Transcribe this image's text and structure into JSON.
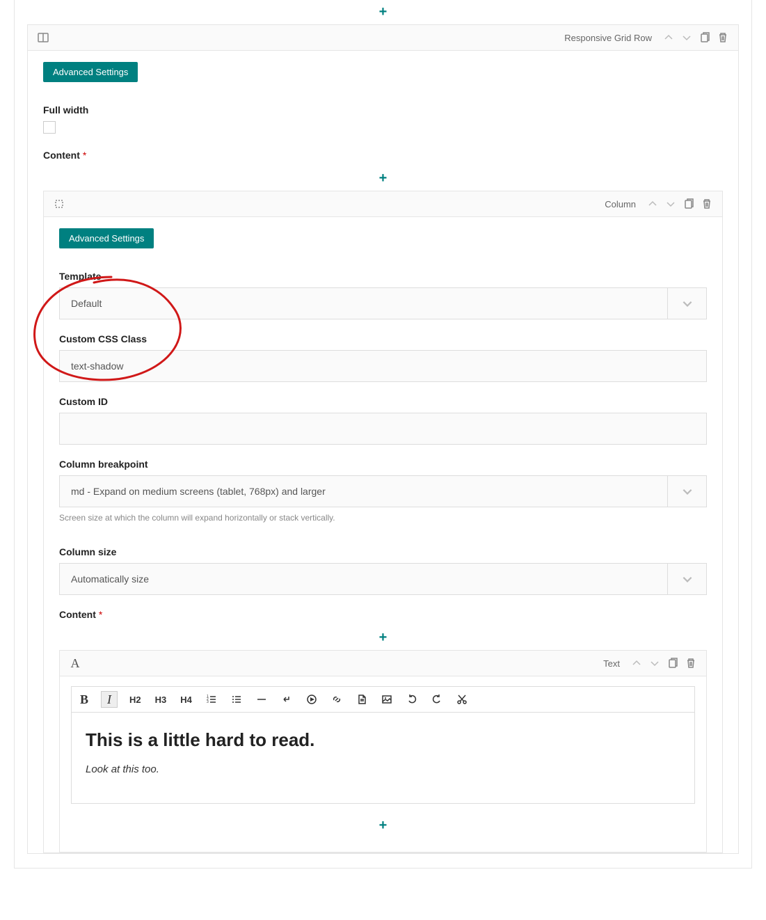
{
  "row": {
    "type_label": "Responsive Grid Row",
    "adv_settings": "Advanced Settings",
    "full_width_label": "Full width",
    "content_label": "Content"
  },
  "column": {
    "type_label": "Column",
    "adv_settings": "Advanced Settings",
    "template_label": "Template",
    "template_value": "Default",
    "css_class_label": "Custom CSS Class",
    "css_class_value": "text-shadow",
    "custom_id_label": "Custom ID",
    "custom_id_value": "",
    "breakpoint_label": "Column breakpoint",
    "breakpoint_value": "md - Expand on medium screens (tablet, 768px) and larger",
    "breakpoint_help": "Screen size at which the column will expand horizontally or stack vertically.",
    "size_label": "Column size",
    "size_value": "Automatically size",
    "content_label": "Content"
  },
  "text_block": {
    "type_label": "Text",
    "heading_text": "This is a little hard to read.",
    "paragraph_text": "Look at this too.",
    "toolbar": {
      "h2": "H2",
      "h3": "H3",
      "h4": "H4"
    }
  }
}
